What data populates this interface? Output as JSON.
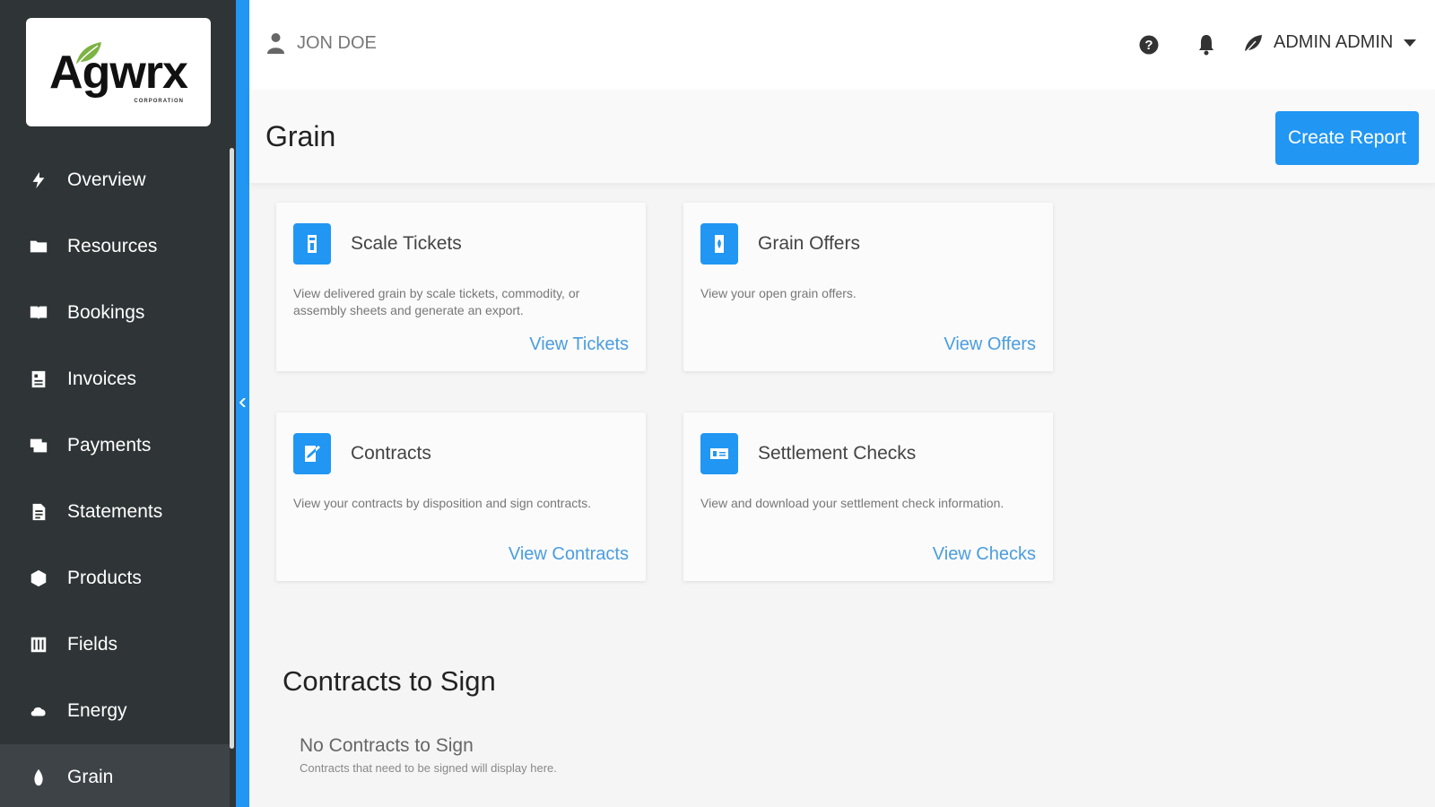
{
  "sidebar": {
    "logo": {
      "text": "Agwrx",
      "subtext": "CORPORATION"
    },
    "items": [
      {
        "label": "Overview",
        "icon": "bolt-icon"
      },
      {
        "label": "Resources",
        "icon": "folder-icon"
      },
      {
        "label": "Bookings",
        "icon": "book-icon"
      },
      {
        "label": "Invoices",
        "icon": "invoice-icon"
      },
      {
        "label": "Payments",
        "icon": "payments-icon"
      },
      {
        "label": "Statements",
        "icon": "statement-icon"
      },
      {
        "label": "Products",
        "icon": "products-icon"
      },
      {
        "label": "Fields",
        "icon": "fields-icon"
      },
      {
        "label": "Energy",
        "icon": "energy-icon"
      },
      {
        "label": "Grain",
        "icon": "grain-icon",
        "active": true
      }
    ]
  },
  "header": {
    "user_name": "JON DOE",
    "admin_name": "ADMIN ADMIN"
  },
  "page": {
    "title": "Grain",
    "create_report_label": "Create Report"
  },
  "cards": [
    {
      "title": "Scale Tickets",
      "description": "View delivered grain by scale tickets, commodity, or assembly sheets and generate an export.",
      "link": "View Tickets",
      "icon": "scale-ticket-icon"
    },
    {
      "title": "Grain Offers",
      "description": "View your open grain offers.",
      "link": "View Offers",
      "icon": "grain-offer-icon"
    },
    {
      "title": "Contracts",
      "description": "View your contracts by disposition and sign contracts.",
      "link": "View Contracts",
      "icon": "contract-icon"
    },
    {
      "title": "Settlement Checks",
      "description": "View and download your settlement check information.",
      "link": "View Checks",
      "icon": "settlement-check-icon"
    }
  ],
  "contracts_to_sign": {
    "title": "Contracts to Sign",
    "empty_title": "No Contracts to Sign",
    "empty_desc": "Contracts that need to be signed will display here."
  },
  "colors": {
    "sidebar_bg": "#2f3437",
    "accent": "#2196f3",
    "link": "#4a9de0"
  }
}
